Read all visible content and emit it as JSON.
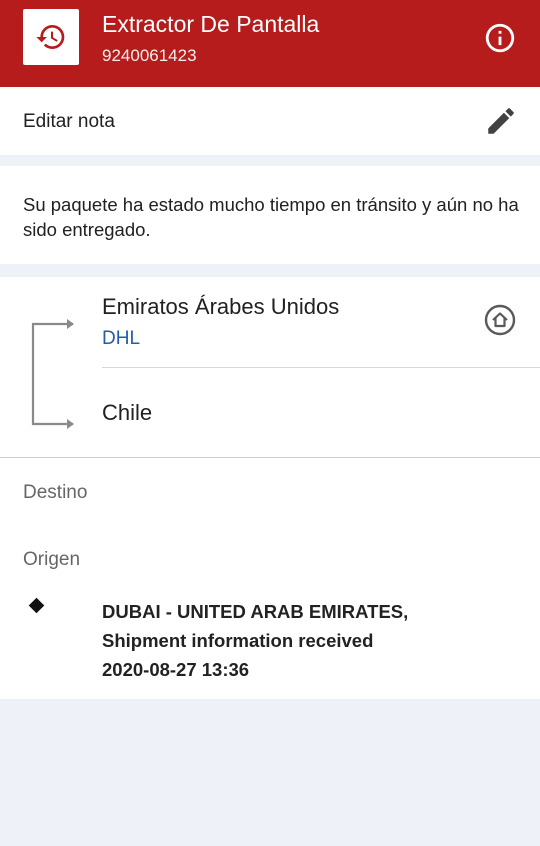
{
  "header": {
    "title": "Extractor De Pantalla",
    "tracking_number": "9240061423",
    "app_icon": "history-icon",
    "info_icon": "info-icon",
    "background_color": "#b71c1c"
  },
  "note": {
    "label": "Editar nota",
    "edit_icon": "pencil-icon"
  },
  "status": {
    "message": "Su paquete ha estado mucho tiempo en tránsito y aún no ha sido entregado."
  },
  "route": {
    "origin_country": "Emiratos Árabes Unidos",
    "carrier": "DHL",
    "carrier_color": "#1f5fa8",
    "home_icon": "home-icon",
    "destination_country": "Chile"
  },
  "labels": {
    "destino": "Destino",
    "origen": "Origen"
  },
  "events": [
    {
      "location": "DUBAI - UNITED ARAB EMIRATES,",
      "description": "Shipment information received",
      "datetime": "2020-08-27 13:36"
    }
  ]
}
